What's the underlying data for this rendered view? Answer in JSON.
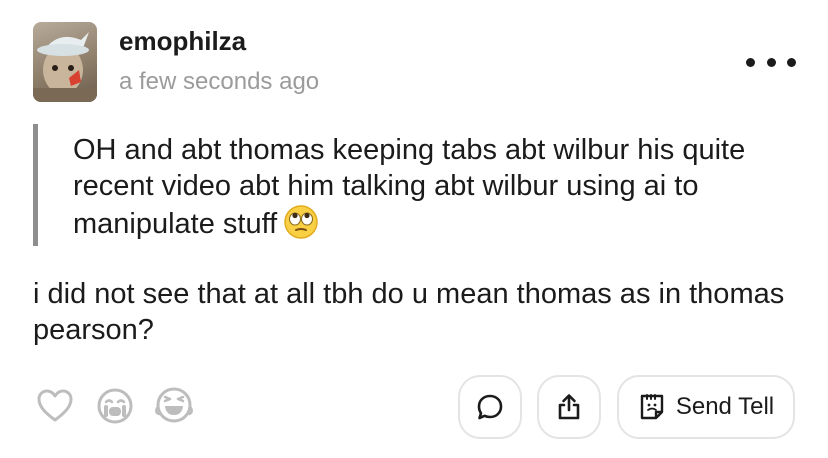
{
  "post": {
    "author": "emophilza",
    "timestamp": "a few seconds ago",
    "quote_text": "OH and abt thomas keeping tabs abt wilbur his quite recent video abt him talking abt wilbur using ai to manipulate stuff",
    "quote_emoji": "face-with-rolling-eyes",
    "reply_text": "i did not see that at all tbh do u mean thomas as in thomas pearson?"
  },
  "actions": {
    "send_tell_label": "Send Tell"
  },
  "icons": {
    "more": "more-dots-icon",
    "like": "heart-icon",
    "cry": "crying-face-icon",
    "laugh": "laughing-face-icon",
    "comment": "comment-bubble-icon",
    "share": "share-icon",
    "tell": "tell-note-icon"
  },
  "colors": {
    "text": "#1b1b1b",
    "muted": "#9b9b9b",
    "quote_bar": "#8e8e8e",
    "button_border": "#e4e4e4",
    "icon_gray": "#bdbdbd"
  }
}
